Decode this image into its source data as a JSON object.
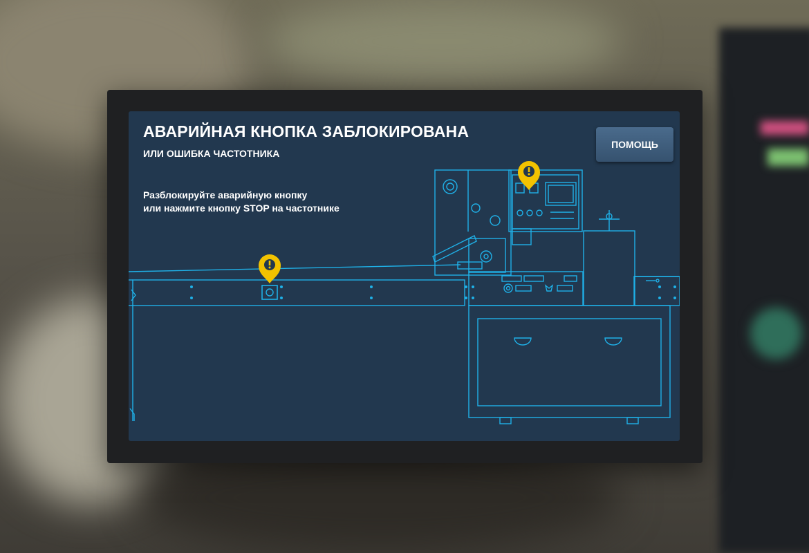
{
  "alert": {
    "title": "АВАРИЙНАЯ КНОПКА ЗАБЛОКИРОВАНА",
    "subtitle": "ИЛИ ОШИБКА ЧАСТОТНИКА",
    "instructions": [
      "Разблокируйте аварийную кнопку",
      "или нажмите кнопку STOP на частотнике"
    ]
  },
  "help_button": {
    "label": "ПОМОЩЬ"
  },
  "markers": [
    {
      "name": "emergency-button-marker",
      "icon": "exclamation-pin-icon",
      "target": "emergency-stop-button"
    },
    {
      "name": "frequency-converter-marker",
      "icon": "exclamation-pin-icon",
      "target": "frequency-converter"
    }
  ],
  "colors": {
    "screen_bg": "#22384f",
    "line": "#1fb1e8",
    "marker": "#f2c200",
    "text": "#ffffff"
  }
}
